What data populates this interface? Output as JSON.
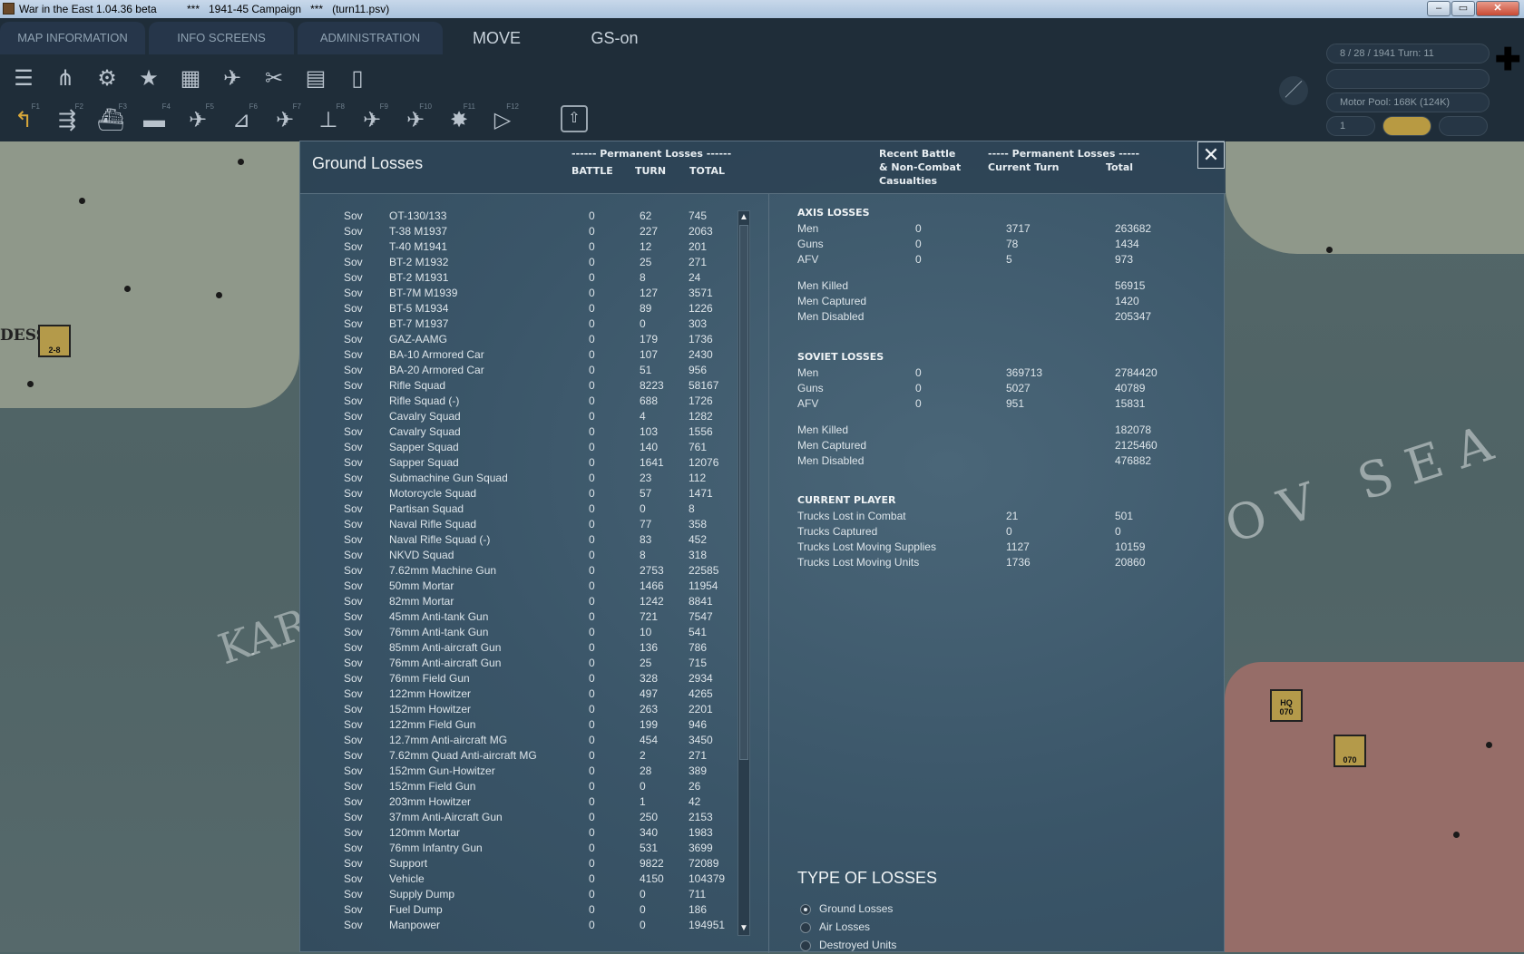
{
  "window": {
    "title": "War in the East 1.04.36 beta          ***   1941-45 Campaign   ***   (turn11.psv)",
    "controls": [
      "–",
      "▭",
      "✕"
    ]
  },
  "menu": {
    "tabs": [
      "MAP INFORMATION",
      "INFO SCREENS",
      "ADMINISTRATION",
      "MOVE",
      "GS-on"
    ]
  },
  "status": {
    "date_turn": "8 / 28 / 1941      Turn: 11",
    "motor_pool": "Motor Pool:  168K (124K)",
    "small_value": "1"
  },
  "map": {
    "place_label": "DESSA",
    "sea_label": "OV SEA",
    "sea_label_2": "KAR",
    "unit_left": "2-8",
    "unit_hq": "HQ",
    "unit_hq_sub": "070",
    "unit_inf": "070"
  },
  "toolbar": {
    "row1_icons": [
      "layers-icon",
      "unit-counters-icon",
      "gear-icon",
      "star-icon",
      "weather-icon",
      "air-missions-icon",
      "satellite-icon",
      "supply-depot-icon",
      "clipboard-icon"
    ],
    "row2_icons": [
      "move-path-icon",
      "rail-icon",
      "naval-icon",
      "ship-icon",
      "air-recon-icon",
      "air-transfer-icon",
      "air-attack-icon",
      "bomber-icon",
      "fighter-icon",
      "interdiction-icon",
      "explosion-icon",
      "play-icon"
    ],
    "fkeys": [
      "F1",
      "F2",
      "F3",
      "F4",
      "F5",
      "F6",
      "F7",
      "F8",
      "F9",
      "F10",
      "F11",
      "F12"
    ]
  },
  "dialog": {
    "title": "Ground Losses",
    "left_header_group": "------ Permanent Losses ------",
    "left_col_battle": "BATTLE",
    "left_col_turn": "TURN",
    "left_col_total": "TOTAL",
    "right_header_recent_1": "Recent Battle",
    "right_header_recent_2": "& Non-Combat",
    "right_header_recent_3": "Casualties",
    "right_header_group": "----- Permanent Losses -----",
    "right_col_current": "Current Turn",
    "right_col_total": "Total",
    "close": "✕",
    "scroll_up": "▲",
    "scroll_down": "▼"
  },
  "ground_losses": [
    {
      "side": "Sov",
      "name": "OT-130/133",
      "battle": "0",
      "turn": "62",
      "total": "745"
    },
    {
      "side": "Sov",
      "name": "T-38 M1937",
      "battle": "0",
      "turn": "227",
      "total": "2063"
    },
    {
      "side": "Sov",
      "name": "T-40 M1941",
      "battle": "0",
      "turn": "12",
      "total": "201"
    },
    {
      "side": "Sov",
      "name": "BT-2 M1932",
      "battle": "0",
      "turn": "25",
      "total": "271"
    },
    {
      "side": "Sov",
      "name": "BT-2 M1931",
      "battle": "0",
      "turn": "8",
      "total": "24"
    },
    {
      "side": "Sov",
      "name": "BT-7M M1939",
      "battle": "0",
      "turn": "127",
      "total": "3571"
    },
    {
      "side": "Sov",
      "name": "BT-5 M1934",
      "battle": "0",
      "turn": "89",
      "total": "1226"
    },
    {
      "side": "Sov",
      "name": "BT-7 M1937",
      "battle": "0",
      "turn": "0",
      "total": "303"
    },
    {
      "side": "Sov",
      "name": "GAZ-AAMG",
      "battle": "0",
      "turn": "179",
      "total": "1736"
    },
    {
      "side": "Sov",
      "name": "BA-10 Armored Car",
      "battle": "0",
      "turn": "107",
      "total": "2430"
    },
    {
      "side": "Sov",
      "name": "BA-20 Armored Car",
      "battle": "0",
      "turn": "51",
      "total": "956"
    },
    {
      "side": "Sov",
      "name": "Rifle Squad",
      "battle": "0",
      "turn": "8223",
      "total": "58167"
    },
    {
      "side": "Sov",
      "name": "Rifle Squad (-)",
      "battle": "0",
      "turn": "688",
      "total": "1726"
    },
    {
      "side": "Sov",
      "name": "Cavalry Squad",
      "battle": "0",
      "turn": "4",
      "total": "1282"
    },
    {
      "side": "Sov",
      "name": "Cavalry Squad",
      "battle": "0",
      "turn": "103",
      "total": "1556"
    },
    {
      "side": "Sov",
      "name": "Sapper Squad",
      "battle": "0",
      "turn": "140",
      "total": "761"
    },
    {
      "side": "Sov",
      "name": "Sapper Squad",
      "battle": "0",
      "turn": "1641",
      "total": "12076"
    },
    {
      "side": "Sov",
      "name": "Submachine Gun Squad",
      "battle": "0",
      "turn": "23",
      "total": "112"
    },
    {
      "side": "Sov",
      "name": "Motorcycle Squad",
      "battle": "0",
      "turn": "57",
      "total": "1471"
    },
    {
      "side": "Sov",
      "name": "Partisan Squad",
      "battle": "0",
      "turn": "0",
      "total": "8"
    },
    {
      "side": "Sov",
      "name": "Naval Rifle Squad",
      "battle": "0",
      "turn": "77",
      "total": "358"
    },
    {
      "side": "Sov",
      "name": "Naval Rifle Squad (-)",
      "battle": "0",
      "turn": "83",
      "total": "452"
    },
    {
      "side": "Sov",
      "name": "NKVD Squad",
      "battle": "0",
      "turn": "8",
      "total": "318"
    },
    {
      "side": "Sov",
      "name": "7.62mm Machine Gun",
      "battle": "0",
      "turn": "2753",
      "total": "22585"
    },
    {
      "side": "Sov",
      "name": "50mm Mortar",
      "battle": "0",
      "turn": "1466",
      "total": "11954"
    },
    {
      "side": "Sov",
      "name": "82mm Mortar",
      "battle": "0",
      "turn": "1242",
      "total": "8841"
    },
    {
      "side": "Sov",
      "name": "45mm Anti-tank Gun",
      "battle": "0",
      "turn": "721",
      "total": "7547"
    },
    {
      "side": "Sov",
      "name": "76mm Anti-tank Gun",
      "battle": "0",
      "turn": "10",
      "total": "541"
    },
    {
      "side": "Sov",
      "name": "85mm Anti-aircraft Gun",
      "battle": "0",
      "turn": "136",
      "total": "786"
    },
    {
      "side": "Sov",
      "name": "76mm Anti-aircraft Gun",
      "battle": "0",
      "turn": "25",
      "total": "715"
    },
    {
      "side": "Sov",
      "name": "76mm Field Gun",
      "battle": "0",
      "turn": "328",
      "total": "2934"
    },
    {
      "side": "Sov",
      "name": "122mm Howitzer",
      "battle": "0",
      "turn": "497",
      "total": "4265"
    },
    {
      "side": "Sov",
      "name": "152mm Howitzer",
      "battle": "0",
      "turn": "263",
      "total": "2201"
    },
    {
      "side": "Sov",
      "name": "122mm Field Gun",
      "battle": "0",
      "turn": "199",
      "total": "946"
    },
    {
      "side": "Sov",
      "name": "12.7mm Anti-aircraft MG",
      "battle": "0",
      "turn": "454",
      "total": "3450"
    },
    {
      "side": "Sov",
      "name": "7.62mm Quad Anti-aircraft MG",
      "battle": "0",
      "turn": "2",
      "total": "271"
    },
    {
      "side": "Sov",
      "name": "152mm Gun-Howitzer",
      "battle": "0",
      "turn": "28",
      "total": "389"
    },
    {
      "side": "Sov",
      "name": "152mm Field Gun",
      "battle": "0",
      "turn": "0",
      "total": "26"
    },
    {
      "side": "Sov",
      "name": "203mm Howitzer",
      "battle": "0",
      "turn": "1",
      "total": "42"
    },
    {
      "side": "Sov",
      "name": "37mm Anti-Aircraft Gun",
      "battle": "0",
      "turn": "250",
      "total": "2153"
    },
    {
      "side": "Sov",
      "name": "120mm Mortar",
      "battle": "0",
      "turn": "340",
      "total": "1983"
    },
    {
      "side": "Sov",
      "name": "76mm Infantry Gun",
      "battle": "0",
      "turn": "531",
      "total": "3699"
    },
    {
      "side": "Sov",
      "name": "Support",
      "battle": "0",
      "turn": "9822",
      "total": "72089"
    },
    {
      "side": "Sov",
      "name": "Vehicle",
      "battle": "0",
      "turn": "4150",
      "total": "104379"
    },
    {
      "side": "Sov",
      "name": "Supply Dump",
      "battle": "0",
      "turn": "0",
      "total": "711"
    },
    {
      "side": "Sov",
      "name": "Fuel Dump",
      "battle": "0",
      "turn": "0",
      "total": "186"
    },
    {
      "side": "Sov",
      "name": "Manpower",
      "battle": "0",
      "turn": "0",
      "total": "194951"
    }
  ],
  "summary": {
    "axis_title": "AXIS LOSSES",
    "axis_rows": [
      {
        "label": "Men",
        "battle": "0",
        "turn": "3717",
        "total": "263682"
      },
      {
        "label": "Guns",
        "battle": "0",
        "turn": "78",
        "total": "1434"
      },
      {
        "label": "AFV",
        "battle": "0",
        "turn": "5",
        "total": "973"
      }
    ],
    "axis_men_rows": [
      {
        "label": "Men Killed",
        "total": "56915"
      },
      {
        "label": "Men Captured",
        "total": "1420"
      },
      {
        "label": "Men Disabled",
        "total": "205347"
      }
    ],
    "soviet_title": "SOVIET LOSSES",
    "soviet_rows": [
      {
        "label": "Men",
        "battle": "0",
        "turn": "369713",
        "total": "2784420"
      },
      {
        "label": "Guns",
        "battle": "0",
        "turn": "5027",
        "total": "40789"
      },
      {
        "label": "AFV",
        "battle": "0",
        "turn": "951",
        "total": "15831"
      }
    ],
    "soviet_men_rows": [
      {
        "label": "Men Killed",
        "total": "182078"
      },
      {
        "label": "Men Captured",
        "total": "2125460"
      },
      {
        "label": "Men Disabled",
        "total": "476882"
      }
    ],
    "player_title": "CURRENT PLAYER",
    "player_rows": [
      {
        "label": "Trucks Lost in Combat",
        "turn": "21",
        "total": "501"
      },
      {
        "label": "Trucks Captured",
        "turn": "0",
        "total": "0"
      },
      {
        "label": "Trucks Lost Moving Supplies",
        "turn": "1127",
        "total": "10159"
      },
      {
        "label": "Trucks Lost Moving Units",
        "turn": "1736",
        "total": "20860"
      }
    ]
  },
  "loss_types": {
    "title": "TYPE OF LOSSES",
    "options": [
      {
        "label": "Ground Losses",
        "selected": true
      },
      {
        "label": "Air Losses",
        "selected": false
      },
      {
        "label": "Destroyed Units",
        "selected": false
      }
    ]
  }
}
